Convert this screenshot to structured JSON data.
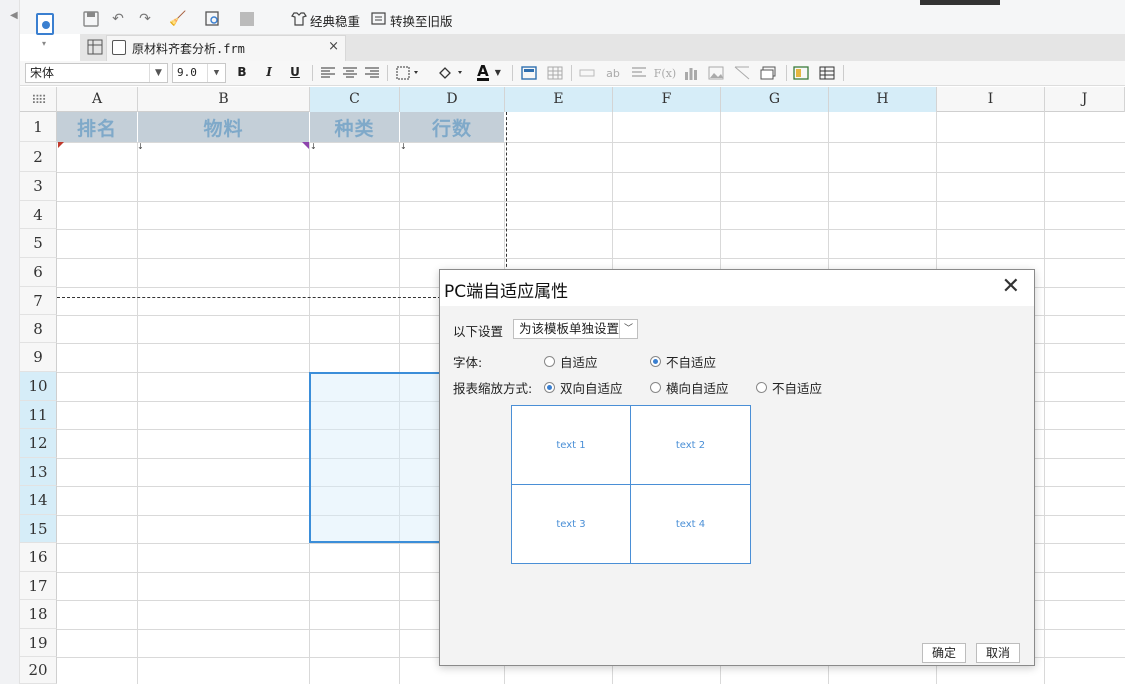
{
  "toolbar": {
    "classic_label": "经典稳重",
    "convert_label": "转换至旧版"
  },
  "file_tab": {
    "name": "原材料齐套分析.frm",
    "close": "×"
  },
  "format_bar": {
    "font_name": "宋体",
    "font_size": "9.0",
    "bold": "B",
    "italic": "I",
    "underline": "U",
    "font_color_glyph": "A"
  },
  "grid": {
    "columns": [
      "A",
      "B",
      "C",
      "D",
      "E",
      "F",
      "G",
      "H",
      "I",
      "J"
    ],
    "rows": [
      "1",
      "2",
      "3",
      "4",
      "5",
      "6",
      "7",
      "8",
      "9",
      "10",
      "11",
      "12",
      "13",
      "14",
      "15",
      "16",
      "17",
      "18",
      "19",
      "20"
    ],
    "header_cells": {
      "a1": "排名",
      "b1": "物料",
      "c1": "种类",
      "d1": "行数"
    }
  },
  "dialog": {
    "title": "PC端自适应属性",
    "close": "✕",
    "setting_label": "以下设置",
    "setting_value": "为该模板单独设置",
    "font_label": "字体:",
    "font_opt_adaptive": "自适应",
    "font_opt_fixed": "不自适应",
    "scale_label": "报表缩放方式:",
    "scale_opt_both": "双向自适应",
    "scale_opt_horizontal": "横向自适应",
    "scale_opt_none": "不自适应",
    "preview": [
      "text 1",
      "text 2",
      "text 3",
      "text 4"
    ],
    "ok": "确定",
    "cancel": "取消"
  },
  "colors": {
    "accent": "#3a7fd0",
    "header_fill": "#c4cfd8",
    "header_text": "#7fa9c9",
    "selection": "#3b8ed9"
  }
}
